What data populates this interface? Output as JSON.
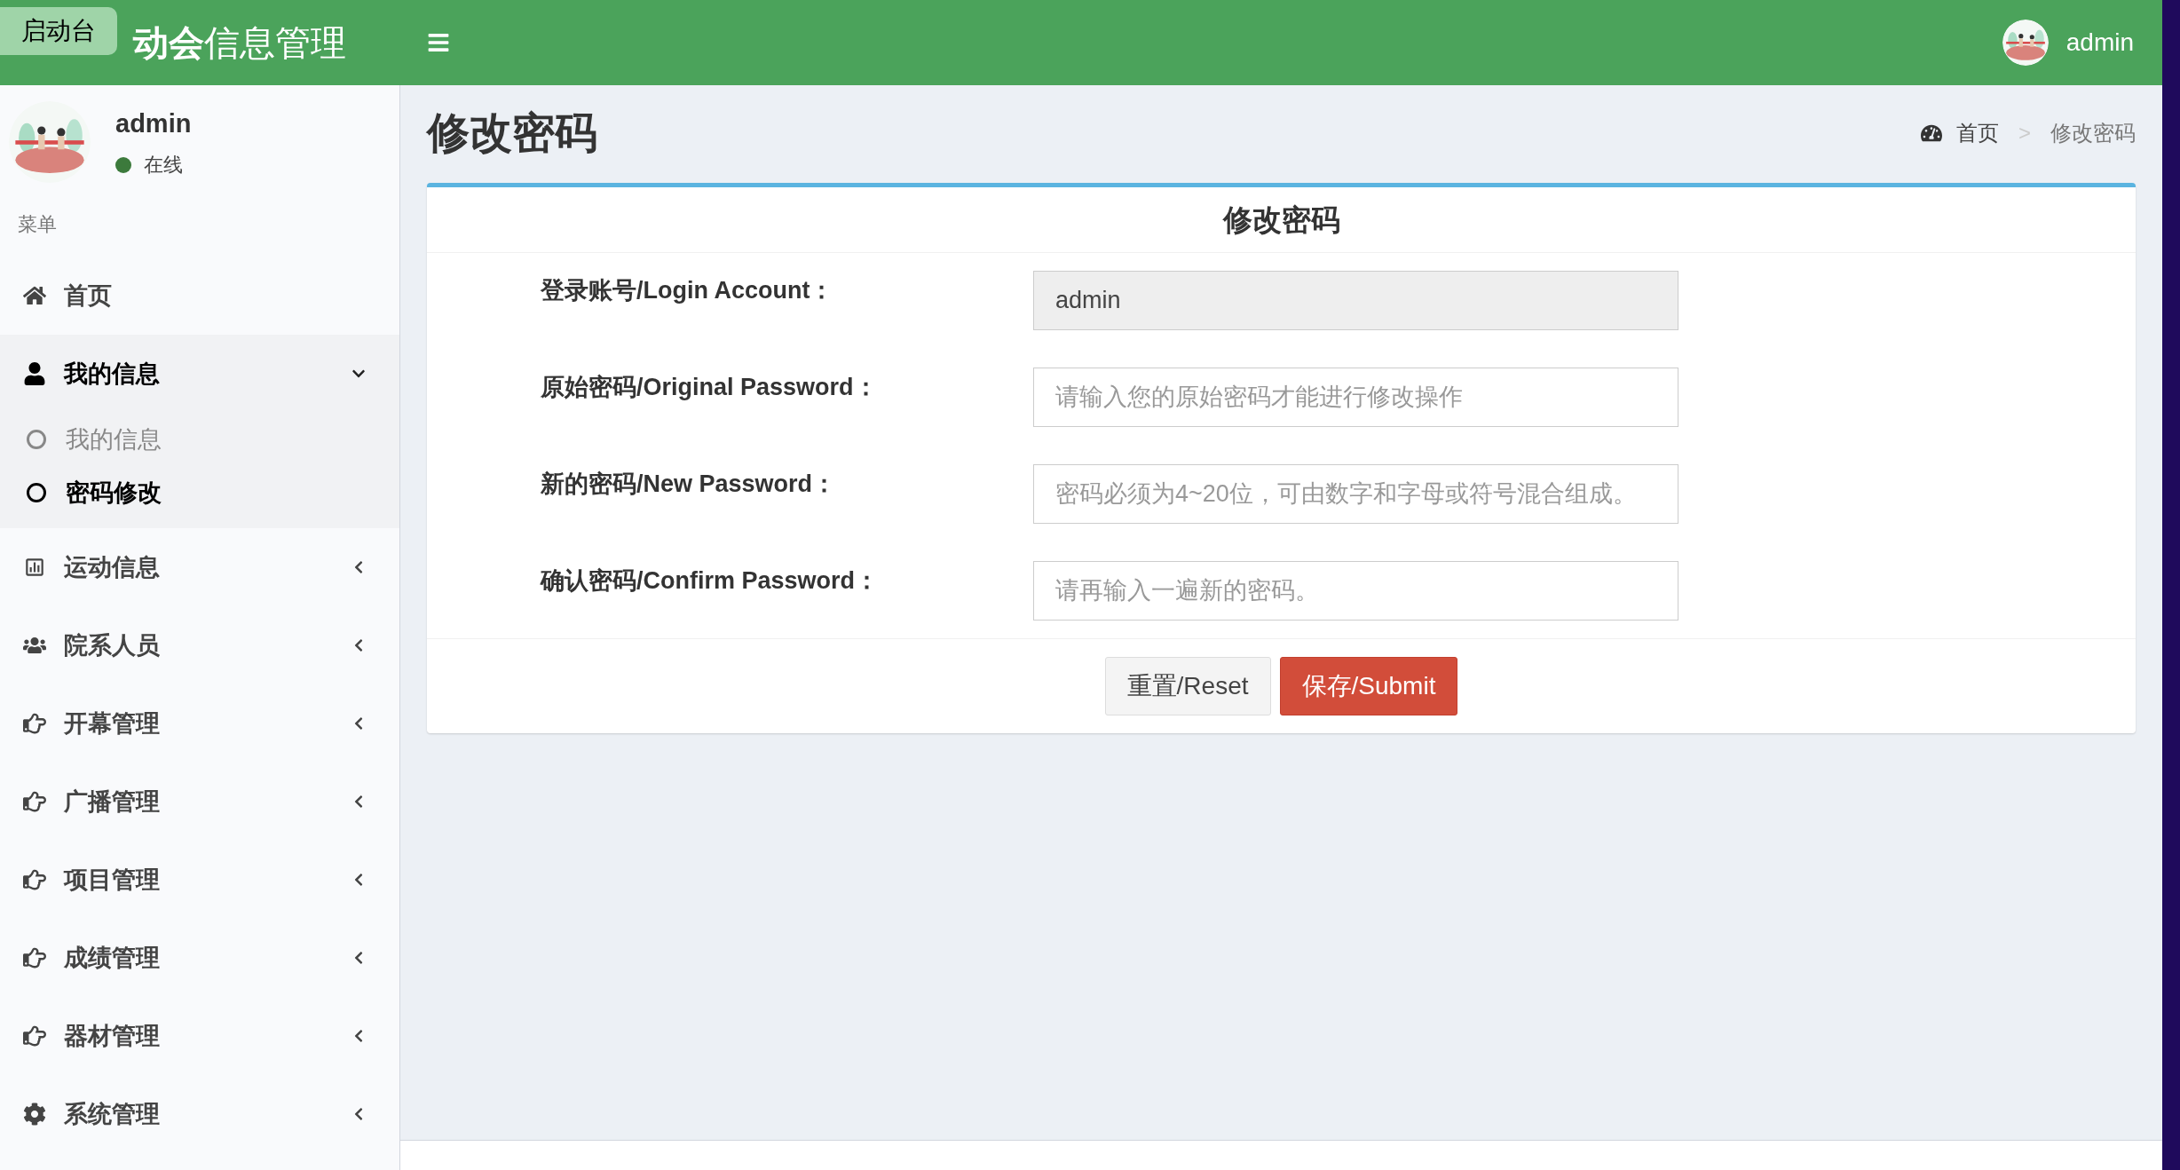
{
  "launcher_tooltip": "启动台",
  "header": {
    "title": "**动会**信息管理",
    "user": "admin"
  },
  "user_panel": {
    "name": "admin",
    "status": "在线",
    "online": true
  },
  "menu_heading": "菜单",
  "menu": [
    {
      "label": "首页"
    },
    {
      "label": "我的信息",
      "expanded": true,
      "children": [
        {
          "label": "我的信息",
          "selected": false
        },
        {
          "label": "密码修改",
          "selected": true
        }
      ]
    },
    {
      "label": "运动信息",
      "expanded": false
    },
    {
      "label": "院系人员",
      "expanded": false
    },
    {
      "label": "开幕管理",
      "expanded": false
    },
    {
      "label": "广播管理",
      "expanded": false
    },
    {
      "label": "项目管理",
      "expanded": false
    },
    {
      "label": "成绩管理",
      "expanded": false
    },
    {
      "label": "器材管理",
      "expanded": false
    },
    {
      "label": "系统管理",
      "expanded": false
    }
  ],
  "page_title": "修改密码",
  "breadcrumb": [
    "首页",
    ">",
    "修改密码"
  ],
  "form": {
    "title": "修改密码",
    "fields": [
      {
        "label": "登录账号/Login Account：",
        "value": "admin",
        "disabled": true
      },
      {
        "label": "原始密码/Original Password：",
        "placeholder": "请输入您的原始密码才能进行修改操作",
        "disabled": false
      },
      {
        "label": "新的密码/New Password：",
        "placeholder": "密码必须为4~20位，可由数字和字母或符号混合组成。",
        "disabled": false
      },
      {
        "label": "确认密码/Confirm Password：",
        "placeholder": "请再输入一遍新的密码。",
        "disabled": false
      }
    ],
    "buttons": [
      {
        "label": "重置/Reset",
        "kind": "default"
      },
      {
        "label": "保存/Submit",
        "kind": "danger"
      }
    ]
  }
}
